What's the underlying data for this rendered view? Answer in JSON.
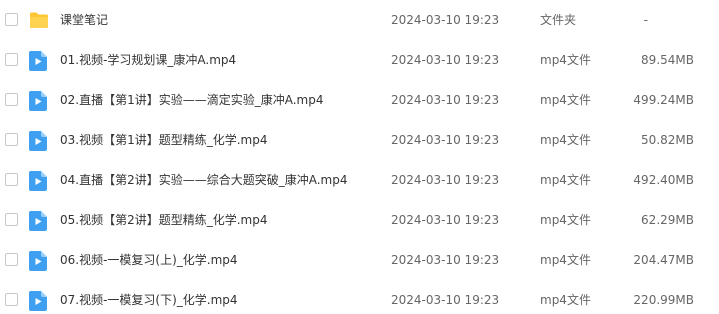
{
  "icons": {
    "folder": "folder-icon",
    "video": "video-file-icon"
  },
  "colors": {
    "folder_yellow": "#FFC634",
    "video_blue": "#3FA0F1"
  },
  "files": [
    {
      "name": "课堂笔记",
      "modified": "2024-03-10 19:23",
      "type": "文件夹",
      "size": "-"
    },
    {
      "name": "01.视频-学习规划课_康冲A.mp4",
      "modified": "2024-03-10 19:23",
      "type": "mp4文件",
      "size": "89.54MB"
    },
    {
      "name": "02.直播【第1讲】实验——滴定实验_康冲A.mp4",
      "modified": "2024-03-10 19:23",
      "type": "mp4文件",
      "size": "499.24MB"
    },
    {
      "name": "03.视频【第1讲】题型精练_化学.mp4",
      "modified": "2024-03-10 19:23",
      "type": "mp4文件",
      "size": "50.82MB"
    },
    {
      "name": "04.直播【第2讲】实验——综合大题突破_康冲A.mp4",
      "modified": "2024-03-10 19:23",
      "type": "mp4文件",
      "size": "492.40MB"
    },
    {
      "name": "05.视频【第2讲】题型精练_化学.mp4",
      "modified": "2024-03-10 19:23",
      "type": "mp4文件",
      "size": "62.29MB"
    },
    {
      "name": "06.视频-一模复习(上)_化学.mp4",
      "modified": "2024-03-10 19:23",
      "type": "mp4文件",
      "size": "204.47MB"
    },
    {
      "name": "07.视频-一模复习(下)_化学.mp4",
      "modified": "2024-03-10 19:23",
      "type": "mp4文件",
      "size": "220.99MB"
    }
  ]
}
